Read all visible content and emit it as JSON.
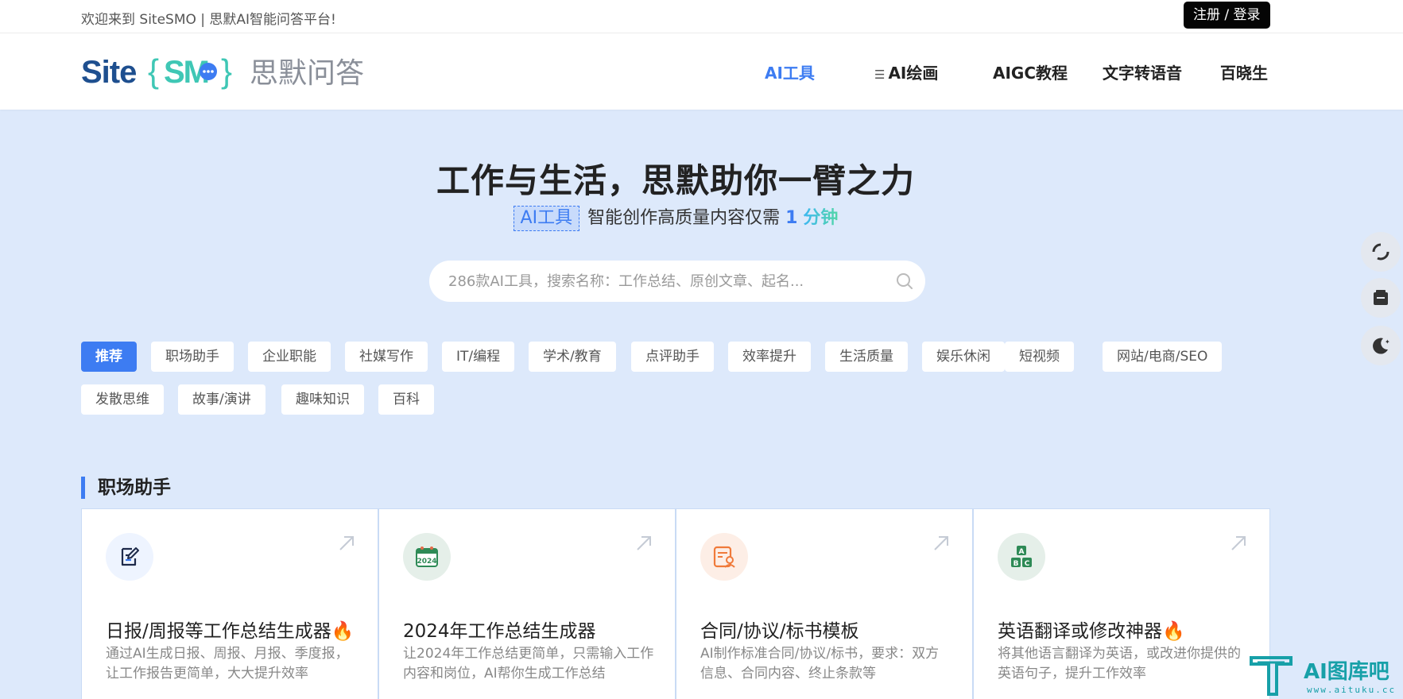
{
  "topbar": {
    "welcome": "欢迎来到 SiteSMO | 思默AI智能问答平台!",
    "login_label": "注册 / 登录"
  },
  "brand": {
    "logo_text_left": "Site",
    "logo_text_mid": "SMO",
    "logo_text_cn": "思默问答",
    "colors": {
      "site": "#1e4f8f",
      "smo": "#3fc7b5",
      "cn": "#8a8f99"
    }
  },
  "nav": {
    "items": [
      {
        "label": "AI工具",
        "active": true
      },
      {
        "label": "AI绘画",
        "icon": "menu-icon"
      },
      {
        "label": "AIGC教程"
      },
      {
        "label": "文字转语音"
      },
      {
        "label": "百晓生"
      }
    ]
  },
  "hero": {
    "title": "工作与生活，思默助你一臂之力",
    "tag": "AI工具",
    "subtitle_text": "智能创作高质量内容仅需",
    "subtitle_num": "1",
    "subtitle_unit": "分钟"
  },
  "search": {
    "placeholder": "286款AI工具，搜索名称：工作总结、原创文章、起名..."
  },
  "categories": [
    "推荐",
    "职场助手",
    "企业职能",
    "社媒写作",
    "IT/编程",
    "学术/教育",
    "点评助手",
    "效率提升",
    "生活质量",
    "娱乐休闲",
    "短视频",
    "网站/电商/SEO",
    "发散思维",
    "故事/演讲",
    "趣味知识",
    "百科"
  ],
  "section": {
    "title": "职场助手"
  },
  "cards": [
    {
      "title": "日报/周报等工作总结生成器🔥",
      "desc": "通过AI生成日报、周报、月报、季度报，让工作报告更简单，大大提升效率",
      "icon": "edit-note-icon",
      "icon_bg": "#eef4ff"
    },
    {
      "title": "2024年工作总结生成器",
      "desc": "让2024年工作总结更简单，只需输入工作内容和岗位，AI帮你生成工作总结",
      "icon": "calendar-2024-icon",
      "icon_label": "2024",
      "icon_bg": "#e5efe9"
    },
    {
      "title": "合同/协议/标书模板",
      "desc": "AI制作标准合同/协议/标书，要求：双方信息、合同内容、终止条款等",
      "icon": "contract-icon",
      "icon_bg": "#fdeee6"
    },
    {
      "title": "英语翻译或修改神器🔥",
      "desc": "将其他语言翻译为英语，或改进你提供的英语句子，提升工作效率",
      "icon": "abc-blocks-icon",
      "icon_label": [
        "A",
        "B",
        "C"
      ],
      "icon_bg": "#e5efe9"
    }
  ],
  "floating": [
    "share-icon",
    "message-icon",
    "dark-mode-icon"
  ],
  "watermark": {
    "text": "AI图库吧",
    "url": "www.aituku.cc"
  }
}
